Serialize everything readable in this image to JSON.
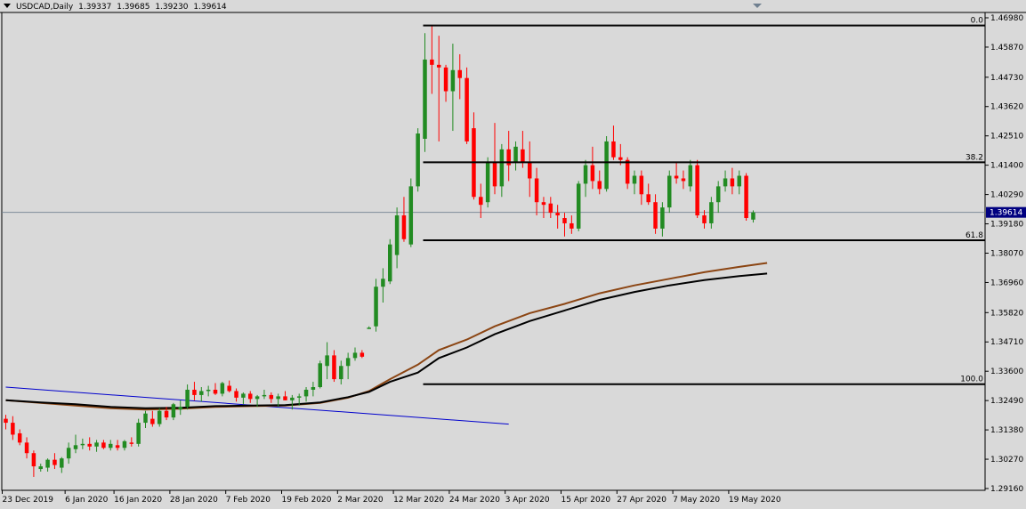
{
  "header": {
    "symbol": "USDCAD,Daily",
    "open": "1.39337",
    "high": "1.39685",
    "low": "1.39230",
    "close": "1.39614"
  },
  "current_price_label": "1.39614",
  "colors": {
    "background": "#d9d9d9",
    "bull_candle": "#228b22",
    "bear_candle": "#ff0000",
    "fib_lines": "#000000",
    "ma_fast": "#000000",
    "ma_slow": "#8b4513",
    "trendline": "#0000cd",
    "price_line": "#708090"
  },
  "chart_data": {
    "type": "candlestick",
    "symbol": "USDCAD",
    "timeframe": "Daily",
    "y_axis": {
      "ticks": [
        "1.46980",
        "1.45870",
        "1.44730",
        "1.43620",
        "1.42510",
        "1.41400",
        "1.40290",
        "1.39180",
        "1.38070",
        "1.36960",
        "1.35820",
        "1.34710",
        "1.33600",
        "1.32490",
        "1.31380",
        "1.30270",
        "1.29160"
      ],
      "range": [
        1.2916,
        1.4698
      ]
    },
    "x_axis": {
      "ticks": [
        "23 Dec 2019",
        "6 Jan 2020",
        "16 Jan 2020",
        "28 Jan 2020",
        "7 Feb 2020",
        "19 Feb 2020",
        "2 Mar 2020",
        "12 Mar 2020",
        "24 Mar 2020",
        "3 Apr 2020",
        "15 Apr 2020",
        "27 Apr 2020",
        "7 May 2020",
        "19 May 2020"
      ],
      "tick_bar_index": [
        0,
        9,
        16,
        24,
        32,
        40,
        48,
        56,
        64,
        72,
        80,
        88,
        96,
        104
      ]
    },
    "fibonacci": [
      {
        "label": "0.0",
        "price": 1.4669
      },
      {
        "label": "38.2",
        "price": 1.4151
      },
      {
        "label": "61.8",
        "price": 1.3856
      },
      {
        "label": "100.0",
        "price": 1.3311
      }
    ],
    "fib_start_bar": 60,
    "ohlc": [
      [
        1.318,
        1.3195,
        1.314,
        1.3165
      ],
      [
        1.3165,
        1.319,
        1.31,
        1.312
      ],
      [
        1.3125,
        1.314,
        1.308,
        1.309
      ],
      [
        1.309,
        1.311,
        1.303,
        1.305
      ],
      [
        1.305,
        1.306,
        1.296,
        1.3
      ],
      [
        1.299,
        1.301,
        1.298,
        1.3
      ],
      [
        1.2995,
        1.303,
        1.298,
        1.3025
      ],
      [
        1.3025,
        1.305,
        1.299,
        1.3005
      ],
      [
        1.2995,
        1.3035,
        1.2975,
        1.303
      ],
      [
        1.303,
        1.309,
        1.301,
        1.307
      ],
      [
        1.3065,
        1.312,
        1.305,
        1.308
      ],
      [
        1.308,
        1.3105,
        1.3065,
        1.3085
      ],
      [
        1.3085,
        1.311,
        1.306,
        1.3075
      ],
      [
        1.3075,
        1.31,
        1.3055,
        1.309
      ],
      [
        1.309,
        1.31,
        1.3065,
        1.307
      ],
      [
        1.307,
        1.31,
        1.306,
        1.3085
      ],
      [
        1.308,
        1.31,
        1.306,
        1.307
      ],
      [
        1.307,
        1.31,
        1.306,
        1.3095
      ],
      [
        1.309,
        1.311,
        1.3075,
        1.3085
      ],
      [
        1.3085,
        1.318,
        1.3075,
        1.3165
      ],
      [
        1.3165,
        1.321,
        1.3145,
        1.32
      ],
      [
        1.318,
        1.321,
        1.315,
        1.316
      ],
      [
        1.316,
        1.322,
        1.315,
        1.321
      ],
      [
        1.321,
        1.3225,
        1.3175,
        1.3185
      ],
      [
        1.3185,
        1.324,
        1.3175,
        1.3235
      ],
      [
        1.3215,
        1.325,
        1.3195,
        1.3225
      ],
      [
        1.3225,
        1.331,
        1.3215,
        1.329
      ],
      [
        1.329,
        1.332,
        1.325,
        1.327
      ],
      [
        1.327,
        1.33,
        1.3245,
        1.3285
      ],
      [
        1.3285,
        1.3305,
        1.3265,
        1.329
      ],
      [
        1.329,
        1.3315,
        1.327,
        1.3275
      ],
      [
        1.3275,
        1.332,
        1.3265,
        1.3315
      ],
      [
        1.3305,
        1.3325,
        1.328,
        1.3285
      ],
      [
        1.3285,
        1.3295,
        1.3245,
        1.326
      ],
      [
        1.326,
        1.328,
        1.3235,
        1.3275
      ],
      [
        1.3275,
        1.3285,
        1.324,
        1.3255
      ],
      [
        1.3255,
        1.327,
        1.3225,
        1.3265
      ],
      [
        1.3265,
        1.329,
        1.3255,
        1.327
      ],
      [
        1.327,
        1.328,
        1.324,
        1.3255
      ],
      [
        1.3255,
        1.3275,
        1.3225,
        1.3265
      ],
      [
        1.3265,
        1.3285,
        1.325,
        1.325
      ],
      [
        1.325,
        1.327,
        1.3215,
        1.326
      ],
      [
        1.326,
        1.3275,
        1.323,
        1.3265
      ],
      [
        1.3265,
        1.33,
        1.3245,
        1.329
      ],
      [
        1.329,
        1.332,
        1.3265,
        1.33
      ],
      [
        1.33,
        1.34,
        1.3295,
        1.339
      ],
      [
        1.338,
        1.347,
        1.333,
        1.342
      ],
      [
        1.342,
        1.344,
        1.332,
        1.333
      ],
      [
        1.333,
        1.34,
        1.331,
        1.338
      ],
      [
        1.338,
        1.343,
        1.333,
        1.341
      ],
      [
        1.341,
        1.345,
        1.34,
        1.343
      ],
      [
        1.343,
        1.344,
        1.341,
        1.3415
      ],
      [
        1.352,
        1.353,
        1.352,
        1.3525
      ],
      [
        1.353,
        1.371,
        1.351,
        1.368
      ],
      [
        1.368,
        1.375,
        1.362,
        1.371
      ],
      [
        1.37,
        1.386,
        1.369,
        1.384
      ],
      [
        1.38,
        1.398,
        1.375,
        1.395
      ],
      [
        1.395,
        1.402,
        1.385,
        1.386
      ],
      [
        1.384,
        1.409,
        1.383,
        1.406
      ],
      [
        1.406,
        1.428,
        1.404,
        1.426
      ],
      [
        1.424,
        1.464,
        1.419,
        1.454
      ],
      [
        1.454,
        1.4669,
        1.441,
        1.452
      ],
      [
        1.452,
        1.463,
        1.423,
        1.451
      ],
      [
        1.451,
        1.452,
        1.438,
        1.442
      ],
      [
        1.442,
        1.46,
        1.427,
        1.45
      ],
      [
        1.45,
        1.456,
        1.439,
        1.447
      ],
      [
        1.447,
        1.451,
        1.422,
        1.423
      ],
      [
        1.428,
        1.434,
        1.401,
        1.402
      ],
      [
        1.402,
        1.407,
        1.394,
        1.399
      ],
      [
        1.4,
        1.417,
        1.398,
        1.415
      ],
      [
        1.415,
        1.43,
        1.403,
        1.406
      ],
      [
        1.406,
        1.422,
        1.402,
        1.42
      ],
      [
        1.42,
        1.427,
        1.408,
        1.414
      ],
      [
        1.415,
        1.423,
        1.412,
        1.421
      ],
      [
        1.42,
        1.427,
        1.413,
        1.415
      ],
      [
        1.415,
        1.423,
        1.402,
        1.409
      ],
      [
        1.409,
        1.413,
        1.395,
        1.4
      ],
      [
        1.4,
        1.402,
        1.394,
        1.399
      ],
      [
        1.3995,
        1.402,
        1.394,
        1.396
      ],
      [
        1.396,
        1.399,
        1.39,
        1.395
      ],
      [
        1.394,
        1.396,
        1.387,
        1.392
      ],
      [
        1.392,
        1.395,
        1.388,
        1.39
      ],
      [
        1.39,
        1.408,
        1.389,
        1.407
      ],
      [
        1.407,
        1.416,
        1.402,
        1.414
      ],
      [
        1.414,
        1.421,
        1.405,
        1.408
      ],
      [
        1.408,
        1.412,
        1.403,
        1.405
      ],
      [
        1.405,
        1.425,
        1.404,
        1.423
      ],
      [
        1.423,
        1.429,
        1.416,
        1.417
      ],
      [
        1.417,
        1.422,
        1.414,
        1.416
      ],
      [
        1.416,
        1.417,
        1.405,
        1.407
      ],
      [
        1.407,
        1.412,
        1.403,
        1.41
      ],
      [
        1.41,
        1.412,
        1.399,
        1.403
      ],
      [
        1.403,
        1.407,
        1.399,
        1.4
      ],
      [
        1.4,
        1.403,
        1.388,
        1.39
      ],
      [
        1.39,
        1.4,
        1.387,
        1.398
      ],
      [
        1.398,
        1.412,
        1.396,
        1.41
      ],
      [
        1.41,
        1.415,
        1.407,
        1.409
      ],
      [
        1.409,
        1.412,
        1.405,
        1.408
      ],
      [
        1.406,
        1.416,
        1.404,
        1.414
      ],
      [
        1.414,
        1.416,
        1.394,
        1.395
      ],
      [
        1.395,
        1.397,
        1.39,
        1.392
      ],
      [
        1.392,
        1.402,
        1.39,
        1.4
      ],
      [
        1.4,
        1.408,
        1.396,
        1.406
      ],
      [
        1.406,
        1.412,
        1.404,
        1.409
      ],
      [
        1.409,
        1.413,
        1.403,
        1.406
      ],
      [
        1.406,
        1.412,
        1.403,
        1.41
      ],
      [
        1.41,
        1.411,
        1.393,
        1.394
      ],
      [
        1.3934,
        1.3969,
        1.3923,
        1.3961
      ]
    ],
    "ma_slow": [
      [
        0,
        1.325
      ],
      [
        5,
        1.324
      ],
      [
        10,
        1.323
      ],
      [
        15,
        1.322
      ],
      [
        20,
        1.3215
      ],
      [
        25,
        1.3218
      ],
      [
        30,
        1.3225
      ],
      [
        35,
        1.3228
      ],
      [
        40,
        1.323
      ],
      [
        45,
        1.324
      ],
      [
        49,
        1.326
      ],
      [
        52,
        1.3285
      ],
      [
        55,
        1.333
      ],
      [
        59,
        1.3385
      ],
      [
        62,
        1.344
      ],
      [
        66,
        1.348
      ],
      [
        70,
        1.353
      ],
      [
        75,
        1.358
      ],
      [
        80,
        1.3615
      ],
      [
        85,
        1.3655
      ],
      [
        90,
        1.3685
      ],
      [
        95,
        1.371
      ],
      [
        100,
        1.3735
      ],
      [
        105,
        1.3755
      ],
      [
        109,
        1.377
      ]
    ],
    "ma_fast": [
      [
        0,
        1.325
      ],
      [
        5,
        1.3242
      ],
      [
        10,
        1.3235
      ],
      [
        15,
        1.3225
      ],
      [
        20,
        1.322
      ],
      [
        25,
        1.3222
      ],
      [
        30,
        1.3228
      ],
      [
        35,
        1.323
      ],
      [
        40,
        1.3232
      ],
      [
        45,
        1.3242
      ],
      [
        49,
        1.3262
      ],
      [
        52,
        1.3282
      ],
      [
        55,
        1.332
      ],
      [
        59,
        1.3355
      ],
      [
        62,
        1.341
      ],
      [
        66,
        1.345
      ],
      [
        70,
        1.35
      ],
      [
        75,
        1.355
      ],
      [
        80,
        1.359
      ],
      [
        85,
        1.363
      ],
      [
        90,
        1.366
      ],
      [
        95,
        1.3685
      ],
      [
        100,
        1.3705
      ],
      [
        105,
        1.372
      ],
      [
        109,
        1.373
      ]
    ],
    "trendline": {
      "from": [
        0,
        1.33
      ],
      "to": [
        72,
        1.316
      ]
    },
    "current_price": 1.39614
  }
}
